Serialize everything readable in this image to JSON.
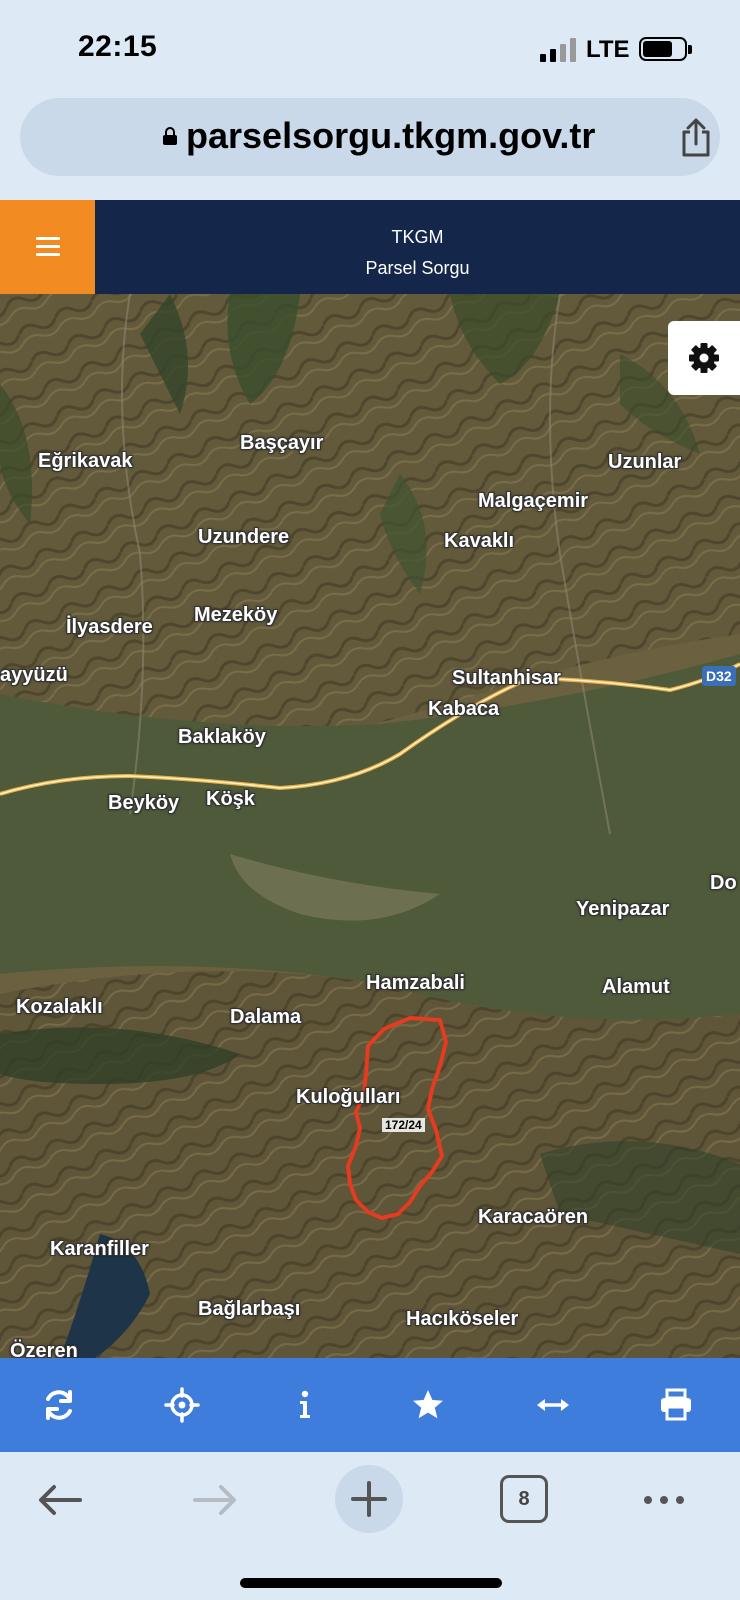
{
  "status_bar": {
    "time": "22:15",
    "network": "LTE"
  },
  "browser": {
    "url": "parselsorgu.tkgm.gov.tr",
    "open_tab_count": "8"
  },
  "header": {
    "title": "TKGM",
    "subtitle": "Parsel Sorgu"
  },
  "map": {
    "places": [
      "Başçayır",
      "Eğrikavak",
      "Uzunlar",
      "Malgaçemir",
      "Uzundere",
      "Kavaklı",
      "İlyasdere",
      "Mezeköy",
      "ayyüzü",
      "Sultanhisar",
      "Kabaca",
      "Baklaköy",
      "Beyköy",
      "Köşk",
      "Do",
      "Yenipazar",
      "Hamzabali",
      "Alamut",
      "Kozalaklı",
      "Dalama",
      "Kuloğulları",
      "Karacaören",
      "Karanfiller",
      "Bağlarbaşı",
      "Hacıköseler",
      "Özeren"
    ],
    "road_badge": "D32",
    "parcel_label": "172/24",
    "parcel_outline_color": "#e53b1f"
  },
  "toolbar": {
    "icons": [
      "refresh-icon",
      "locate-icon",
      "info-icon",
      "star-icon",
      "measure-icon",
      "print-icon"
    ]
  },
  "colors": {
    "header_bg": "#14264a",
    "menu_accent": "#f28b22",
    "toolbar_bg": "#3e7ddb",
    "browser_chrome": "#dde9f4"
  }
}
